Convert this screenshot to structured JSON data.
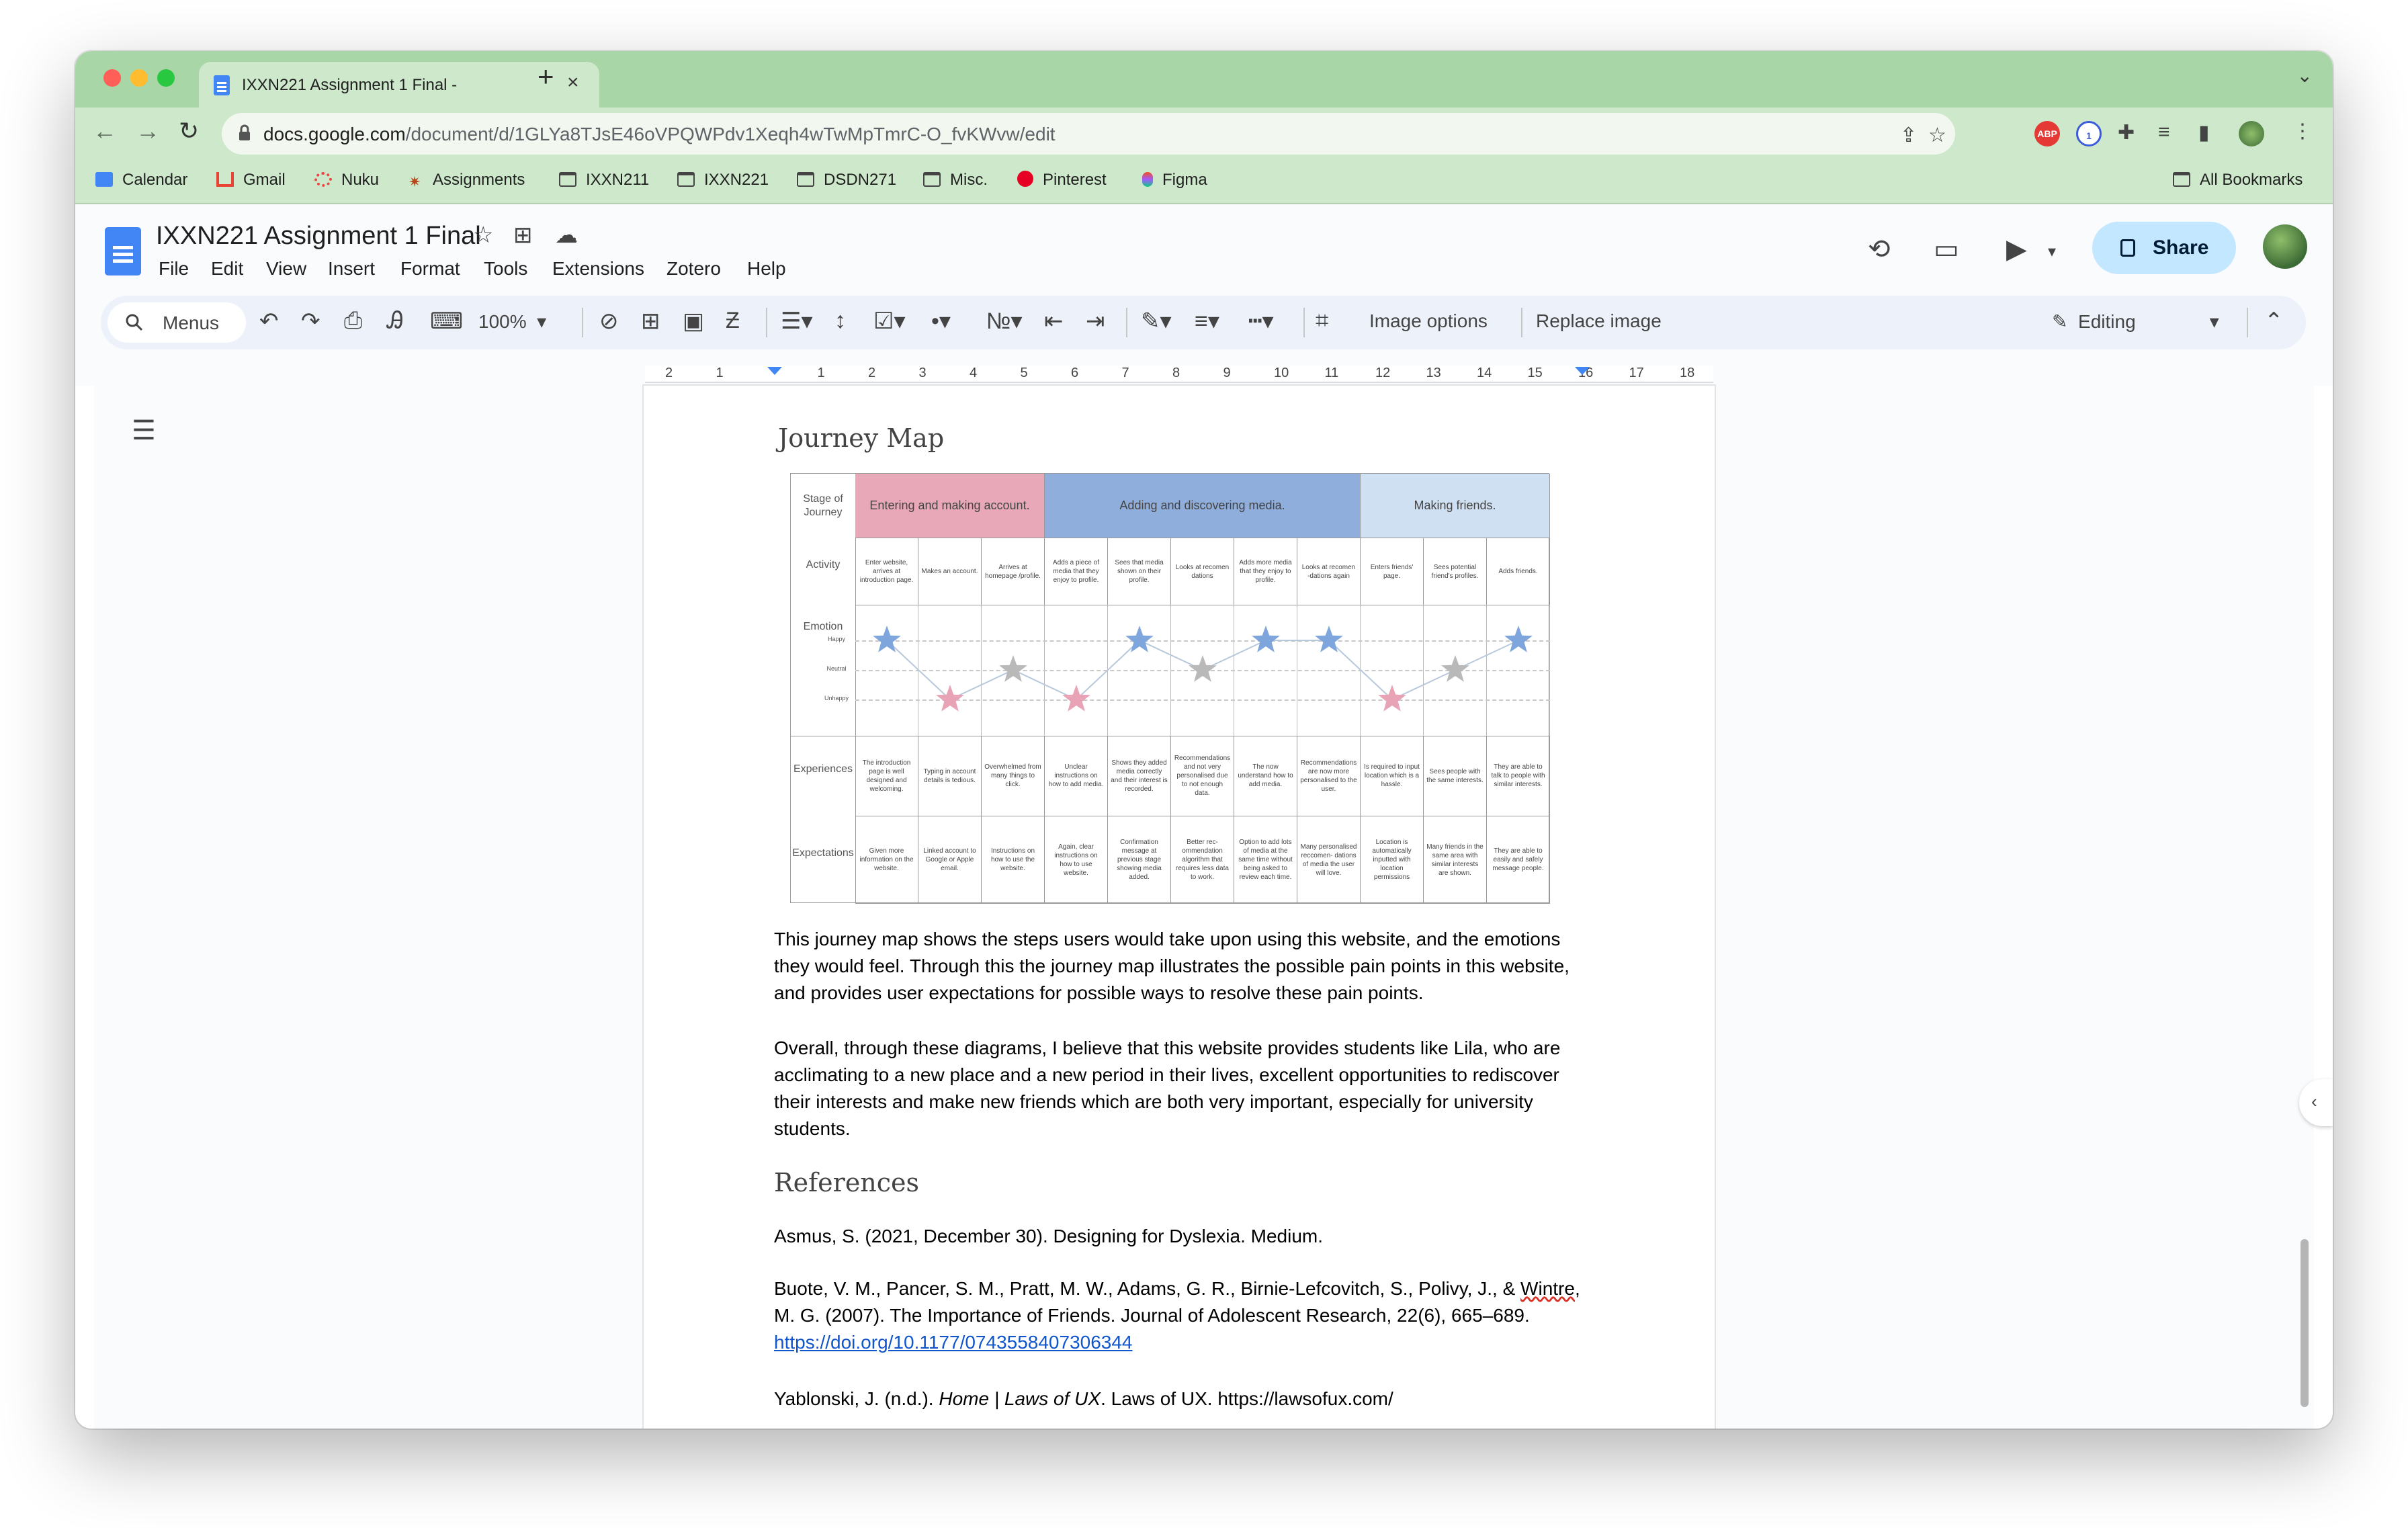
{
  "browser": {
    "tab_title": "IXXN221 Assignment 1 Final -",
    "url_host": "docs.google.com",
    "url_path": "/document/d/1GLYa8TJsE46oVPQWPdv1Xeqh4wTwMpTmrC-O_fvKWvw/edit",
    "bookmarks": [
      "Calendar",
      "Gmail",
      "Nuku",
      "Assignments",
      "IXXN211",
      "IXXN221",
      "DSDN271",
      "Misc.",
      "Pinterest",
      "Figma"
    ],
    "all_bookmarks": "All Bookmarks"
  },
  "doc": {
    "title": "IXXN221 Assignment 1 Final",
    "menus": [
      "File",
      "Edit",
      "View",
      "Insert",
      "Format",
      "Tools",
      "Extensions",
      "Zotero",
      "Help"
    ],
    "share_label": "Share"
  },
  "toolbar": {
    "menus_placeholder": "Menus",
    "zoom": "100%",
    "image_options": "Image options",
    "replace_image": "Replace image",
    "mode": "Editing"
  },
  "ruler": [
    "2",
    "1",
    "",
    "1",
    "2",
    "3",
    "4",
    "5",
    "6",
    "7",
    "8",
    "9",
    "10",
    "11",
    "12",
    "13",
    "14",
    "15",
    "16",
    "17",
    "18"
  ],
  "content": {
    "heading_journey": "Journey Map",
    "journey_map": {
      "row_labels": [
        "Stage of Journey",
        "Activity",
        "Emotion",
        "Experiences",
        "Expectations"
      ],
      "emotion_levels": [
        "Happy",
        "Neutral",
        "Unhappy"
      ],
      "stages": [
        "Entering and making account.",
        "Adding and discovering media.",
        "Making friends."
      ],
      "stage_colors": [
        "#e8a8b8",
        "#8faedc",
        "#cfe0f2"
      ],
      "activities": [
        "Enter website, arrives at introduction page.",
        "Makes an account.",
        "Arrives at homepage /profile.",
        "Adds a piece of media that they enjoy to profile.",
        "Sees that media shown on their profile.",
        "Looks at recomen dations",
        "Adds more media that they enjoy to profile.",
        "Looks at recomen -dations again",
        "Enters friends' page.",
        "Sees potential friend's profiles.",
        "Adds friends."
      ],
      "emotions": [
        "happy",
        "unhappy",
        "neutral",
        "unhappy",
        "happy",
        "neutral",
        "happy",
        "happy",
        "unhappy",
        "neutral",
        "happy"
      ],
      "experiences": [
        "The introduction page is well designed and welcoming.",
        "Typing in account details is tedious.",
        "Overwhelmed from many things to click.",
        "Unclear instructions on how to add media.",
        "Shows they added media correctly and their interest is recorded.",
        "Recommendations and not very personalised due to not enough data.",
        "The now understand how to add media.",
        "Recommendations are now more personalised to the user.",
        "Is required to input location which is a hassle.",
        "Sees people with the same interests.",
        "They are able to talk to people with similar interests."
      ],
      "expectations": [
        "Given more information on the website.",
        "Linked account to Google or Apple email.",
        "Instructions on how to use the website.",
        "Again, clear instructions on how to use website.",
        "Confirmation message at previous stage showing media added.",
        "Better rec- ommendation algorithm that requires less data to work.",
        "Option to add lots of media at the same time without being asked to review each time.",
        "Many personalised reccomen- dations of media the user will love.",
        "Location is automatically inputted with location permissions",
        "Many friends in the same area with similar interests are shown.",
        "They are able to easily and safely message people."
      ]
    },
    "para1": "This journey map shows the steps users would take upon using this website, and the emotions they would feel. Through this the journey map illustrates the possible pain points in this website, and provides user expectations for possible ways to resolve these pain points.",
    "para2": "Overall, through these diagrams, I believe that this website provides students like Lila, who are acclimating to a new place and a new period in their lives, excellent opportunities to rediscover their interests and make new friends which are both very important, especially for university students.",
    "heading_refs": "References",
    "ref1": "Asmus, S. (2021, December 30). Designing for Dyslexia. Medium.",
    "ref2_a": "Buote, V. M., Pancer, S. M., Pratt, M. W., Adams, G. R., Birnie-Lefcovitch, S., Polivy, J., & ",
    "ref2_b": "Wintre",
    "ref2_c": ", M. G. (2007). The Importance of Friends. Journal of Adolescent Research, 22(6), 665–689.",
    "ref2_link": "https://doi.org/10.1177/0743558407306344",
    "ref3_a": "Yablonski, J. (n.d.). ",
    "ref3_b": "Home | Laws of UX",
    "ref3_c": ". Laws of UX. https://lawsofux.com/"
  }
}
